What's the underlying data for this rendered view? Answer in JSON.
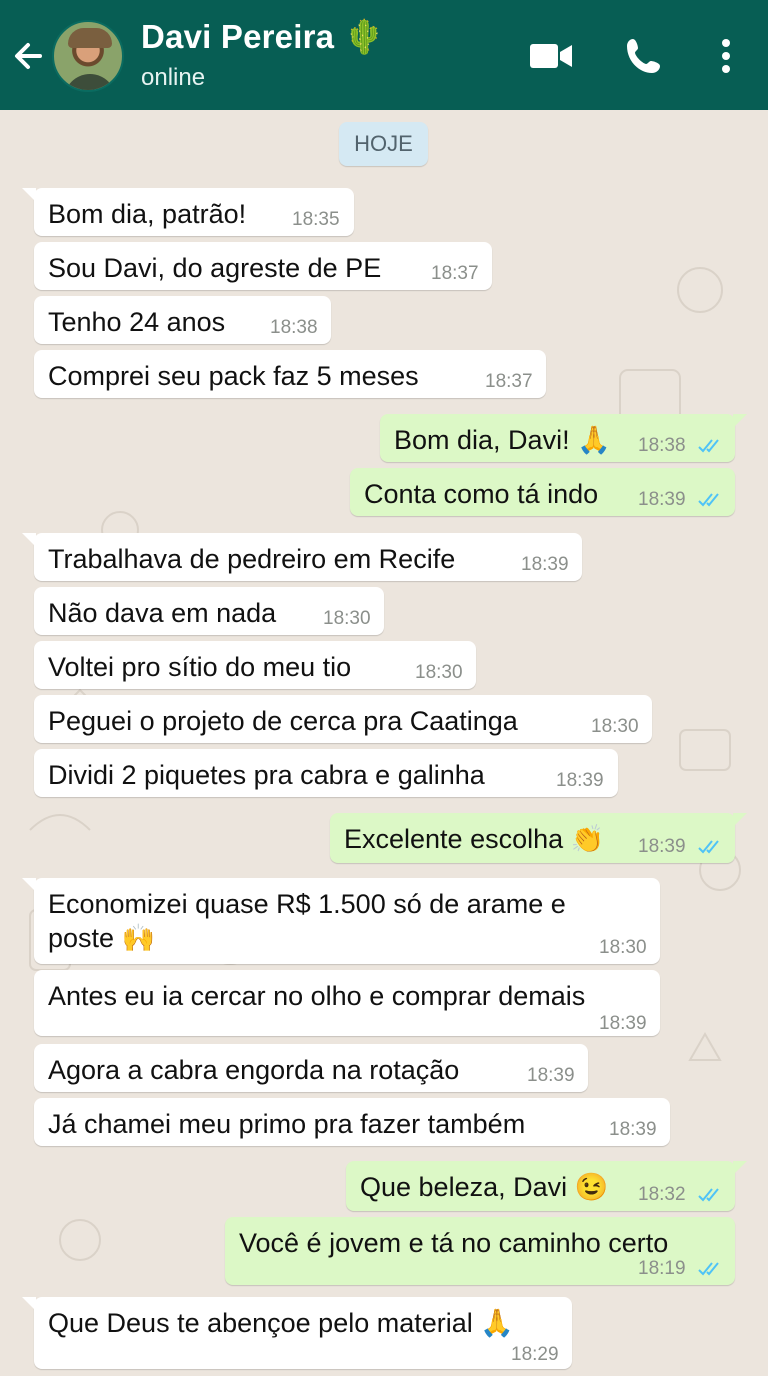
{
  "header": {
    "contact_name": "Davi Pereira 🌵",
    "status": "online",
    "icons": [
      "back-arrow-icon",
      "video-call-icon",
      "phone-icon",
      "more-vertical-icon"
    ],
    "colors": {
      "bar": "#075e54",
      "incoming": "#ffffff",
      "outgoing": "#dcf8c6",
      "ticks": "#4fc3f7"
    }
  },
  "date_chip": "HOJE",
  "messages": [
    {
      "dir": "in",
      "text": "Bom dia, patrão!",
      "time": "18:35"
    },
    {
      "dir": "in",
      "text": "Sou Davi, do agreste de PE",
      "time": "18:37"
    },
    {
      "dir": "in",
      "text": "Tenho 24 anos",
      "time": "18:38"
    },
    {
      "dir": "in",
      "text": "Comprei seu pack faz 5 meses",
      "time": "18:37"
    },
    {
      "dir": "out",
      "text": "Bom dia, Davi! 🙏",
      "time": "18:38"
    },
    {
      "dir": "out",
      "text": "Conta como tá indo",
      "time": "18:39"
    },
    {
      "dir": "in",
      "text": "Trabalhava de pedreiro em Recife",
      "time": "18:39"
    },
    {
      "dir": "in",
      "text": "Não dava em nada",
      "time": "18:30"
    },
    {
      "dir": "in",
      "text": "Voltei pro sítio do meu tio",
      "time": "18:30"
    },
    {
      "dir": "in",
      "text": "Peguei o projeto de cerca pra Caatinga",
      "time": "18:30"
    },
    {
      "dir": "in",
      "text": "Dividi 2 piquetes pra cabra e galinha",
      "time": "18:39"
    },
    {
      "dir": "out",
      "text": "Excelente escolha 👏",
      "time": "18:39"
    },
    {
      "dir": "in",
      "text_line1": "Economizei quase R$ 1.500 só de arame e",
      "text_line2": "poste 🙌",
      "time": "18:30"
    },
    {
      "dir": "in",
      "text": "Antes eu ia cercar no olho e comprar demais",
      "time": "18:39"
    },
    {
      "dir": "in",
      "text": "Agora a cabra engorda na rotação",
      "time": "18:39"
    },
    {
      "dir": "in",
      "text": "Já chamei meu primo pra fazer também",
      "time": "18:39"
    },
    {
      "dir": "out",
      "text": "Que beleza, Davi 😉",
      "time": "18:32"
    },
    {
      "dir": "out",
      "text": "Você é jovem e tá no caminho certo",
      "time": "18:19"
    },
    {
      "dir": "in",
      "text": "Que Deus te abençoe pelo material 🙏",
      "time": "18:29"
    }
  ]
}
